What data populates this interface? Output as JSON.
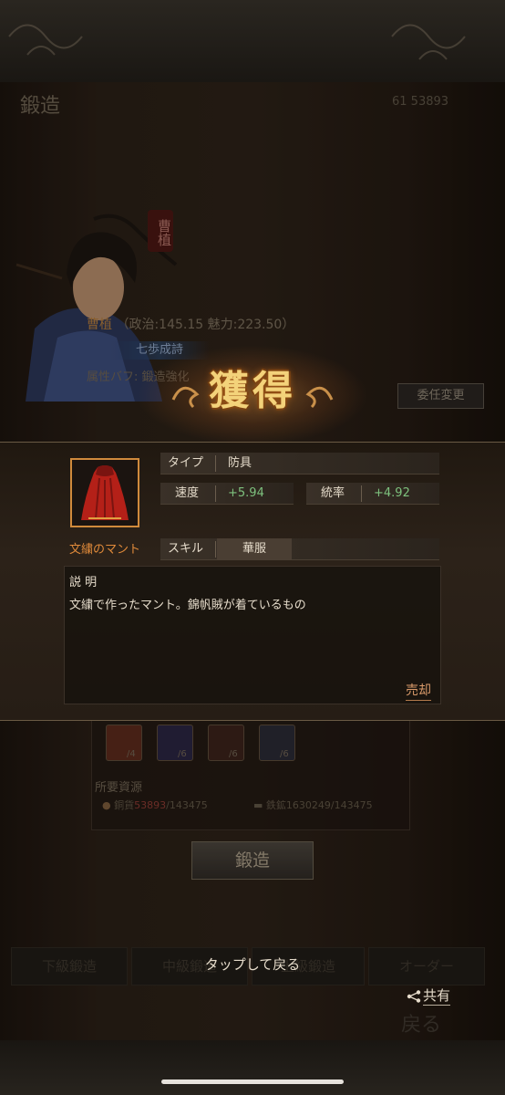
{
  "background": {
    "screen_title": "鍛造",
    "resource_display": "61 53893",
    "hero": {
      "seal_name": "曹植",
      "name": "曹植",
      "stats": "（政治:145.15 魅力:223.50）",
      "skill_banner": "七歩成詩",
      "buff_text": "属性バフ: 鍛造強化"
    },
    "reassign_button": "委任変更",
    "materials": [
      {
        "count": "/4"
      },
      {
        "count": "/6"
      },
      {
        "count": "/6"
      },
      {
        "count": "/6"
      }
    ],
    "requirements_title": "所要資源",
    "requirement_copper": {
      "label": "銅貨",
      "have": "53893",
      "need": "/143475"
    },
    "requirement_iron": {
      "label": "鉄鉱",
      "have": "1630249",
      "need": "/143475"
    },
    "forge_button": "鍛造",
    "bottom_tabs": [
      "下級鍛造",
      "中級鍛造",
      "上級鍛造",
      "オーダー"
    ],
    "back_label": "戻る"
  },
  "popup": {
    "title": "獲得",
    "item_name": "文繍のマント",
    "type_label": "タイプ",
    "type_value": "防具",
    "speed_label": "速度",
    "speed_value": "+5.94",
    "command_label": "統率",
    "command_value": "+4.92",
    "skill_label": "スキル",
    "skill_value": "華服",
    "description_heading": "説 明",
    "description_text": "文繍で作ったマント。錦帆賊が着ているもの",
    "sell_button": "売却"
  },
  "footer": {
    "tap_to_return": "タップして戻る",
    "share_label": "共有"
  },
  "colors": {
    "accent_gold": "#f3d27a",
    "item_name_orange": "#e08a3a",
    "positive_green": "#7ec27e",
    "sell_link": "#d99a6a"
  }
}
